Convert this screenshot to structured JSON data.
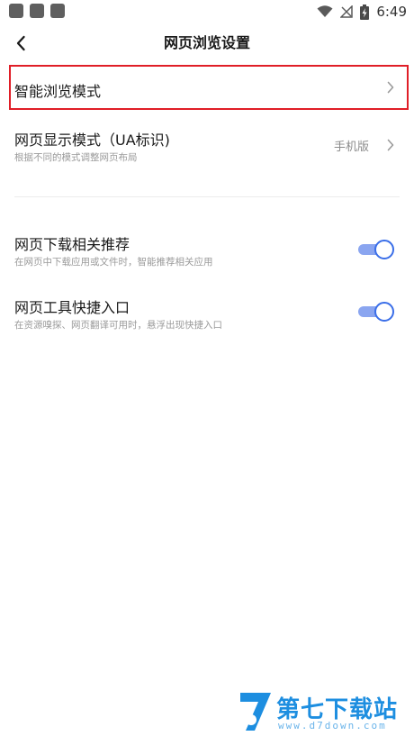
{
  "status_bar": {
    "time": "6:49",
    "icons": [
      "notification-icon",
      "notification-icon",
      "notification-icon",
      "wifi-icon",
      "no-signal-icon",
      "battery-charging-icon"
    ]
  },
  "header": {
    "title": "网页浏览设置",
    "back_icon": "back-arrow-icon"
  },
  "settings": {
    "smart_browse": {
      "title": "智能浏览模式"
    },
    "display_mode": {
      "title": "网页显示模式（UA标识)",
      "subtitle": "根据不同的模式调整网页布局",
      "value": "手机版"
    },
    "download_recommend": {
      "title": "网页下载相关推荐",
      "subtitle": "在网页中下载应用或文件时，智能推荐相关应用",
      "enabled": true
    },
    "tools_shortcut": {
      "title": "网页工具快捷入口",
      "subtitle": "在资源嗅探、网页翻译可用时，悬浮出现快捷入口",
      "enabled": true
    }
  },
  "colors": {
    "highlight_border": "#e01e27",
    "toggle_on": "#3a6ee8",
    "watermark": "#1d8ee0"
  },
  "watermark": {
    "title": "第七下载站",
    "url": "www.d7down.com"
  }
}
